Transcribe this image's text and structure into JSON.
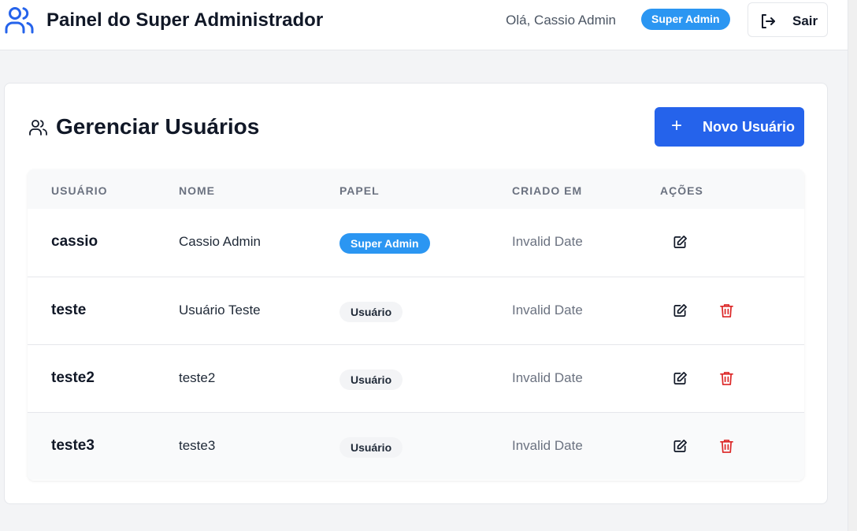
{
  "header": {
    "title": "Painel do Super Administrador",
    "greeting": "Olá, Cassio Admin",
    "role_badge": "Super Admin",
    "logout_label": "Sair"
  },
  "section": {
    "title": "Gerenciar Usuários",
    "new_user_label": "Novo Usuário"
  },
  "table": {
    "columns": [
      "USUÁRIO",
      "NOME",
      "PAPEL",
      "CRIADO EM",
      "AÇÕES"
    ],
    "rows": [
      {
        "username": "cassio",
        "name": "Cassio Admin",
        "role": "Super Admin",
        "created": "Invalid Date"
      },
      {
        "username": "teste",
        "name": "Usuário Teste",
        "role": "Usuário",
        "created": "Invalid Date"
      },
      {
        "username": "teste2",
        "name": "teste2",
        "role": "Usuário",
        "created": "Invalid Date"
      },
      {
        "username": "teste3",
        "name": "teste3",
        "role": "Usuário",
        "created": "Invalid Date"
      }
    ]
  },
  "colors": {
    "primary": "#2563eb",
    "admin_badge": "#2b96f2",
    "danger": "#dc2626"
  },
  "icons": [
    "users-icon",
    "logout-icon",
    "plus-icon",
    "edit-icon",
    "trash-icon"
  ]
}
